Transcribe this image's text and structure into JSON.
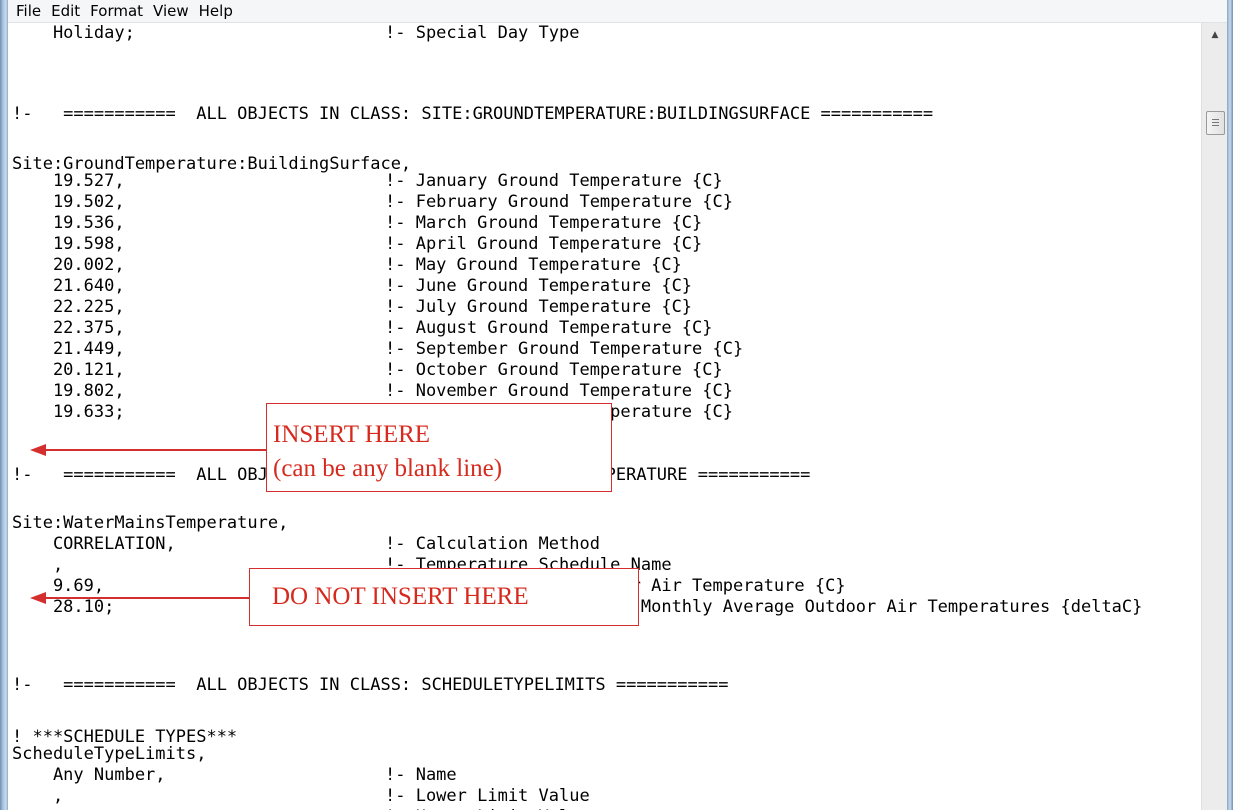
{
  "menu": {
    "file": "File",
    "edit": "Edit",
    "format": "Format",
    "view": "View",
    "help": "Help"
  },
  "lines": [
    {
      "a": "    Holiday;",
      "c": "!- Special Day Type"
    },
    {
      "a": "",
      "c": ""
    },
    {
      "a": "",
      "c": ""
    },
    {
      "a": "!-   ===========  ALL OBJECTS IN CLASS: SITE:GROUNDTEMPERATURE:BUILDINGSURFACE ===========",
      "c": ""
    },
    {
      "a": "",
      "c": ""
    },
    {
      "a": "Site:GroundTemperature:BuildingSurface,",
      "c": ""
    },
    {
      "a": "    19.527,",
      "c": "!- January Ground Temperature {C}"
    },
    {
      "a": "    19.502,",
      "c": "!- February Ground Temperature {C}"
    },
    {
      "a": "    19.536,",
      "c": "!- March Ground Temperature {C}"
    },
    {
      "a": "    19.598,",
      "c": "!- April Ground Temperature {C}"
    },
    {
      "a": "    20.002,",
      "c": "!- May Ground Temperature {C}"
    },
    {
      "a": "    21.640,",
      "c": "!- June Ground Temperature {C}"
    },
    {
      "a": "    22.225,",
      "c": "!- July Ground Temperature {C}"
    },
    {
      "a": "    22.375,",
      "c": "!- August Ground Temperature {C}"
    },
    {
      "a": "    21.449,",
      "c": "!- September Ground Temperature {C}"
    },
    {
      "a": "    20.121,",
      "c": "!- October Ground Temperature {C}"
    },
    {
      "a": "    19.802,",
      "c": "!- November Ground Temperature {C}"
    },
    {
      "a": "    19.633;",
      "c": "!- December Ground Temperature {C}"
    },
    {
      "a": "",
      "c": ""
    },
    {
      "a": "",
      "c": ""
    },
    {
      "a": "!-   ===========  ALL OBJECTS IN CLASS: SITE:WATERMAINSTEMPERATURE ===========",
      "c": ""
    },
    {
      "a": "",
      "c": ""
    },
    {
      "a": "Site:WaterMainsTemperature,",
      "c": ""
    },
    {
      "a": "    CORRELATION,",
      "c": "!- Calculation Method"
    },
    {
      "a": "    ,",
      "c": "!- Temperature Schedule Name"
    },
    {
      "a": "    9.69,",
      "c": "!- Annual Average Outdoor Air Temperature {C}"
    },
    {
      "a": "    28.10;",
      "c": "!- Maximum Difference In Monthly Average Outdoor Air Temperatures {deltaC}"
    },
    {
      "a": "",
      "c": ""
    },
    {
      "a": "",
      "c": ""
    },
    {
      "a": "!-   ===========  ALL OBJECTS IN CLASS: SCHEDULETYPELIMITS ===========",
      "c": ""
    },
    {
      "a": "",
      "c": ""
    },
    {
      "a": "! ***SCHEDULE TYPES***",
      "c": ""
    },
    {
      "a": "ScheduleTypeLimits,",
      "c": ""
    },
    {
      "a": "    Any Number,",
      "c": "!- Name"
    },
    {
      "a": "    ,",
      "c": "!- Lower Limit Value"
    },
    {
      "a": "    ,",
      "c": "!- Upper Limit Value"
    }
  ],
  "callouts": {
    "insert_line1": "INSERT HERE",
    "insert_line2": "(can be any blank line)",
    "no_insert": "DO NOT INSERT HERE"
  },
  "colors": {
    "annotation_red": "#d42e2e",
    "menubar_bg": "#f5f6f7",
    "frame_blue": "#8aa6c4"
  },
  "icons": {
    "scroll_up": "triangle-up-icon",
    "scroll_thumb_grip": "grip-icon"
  }
}
